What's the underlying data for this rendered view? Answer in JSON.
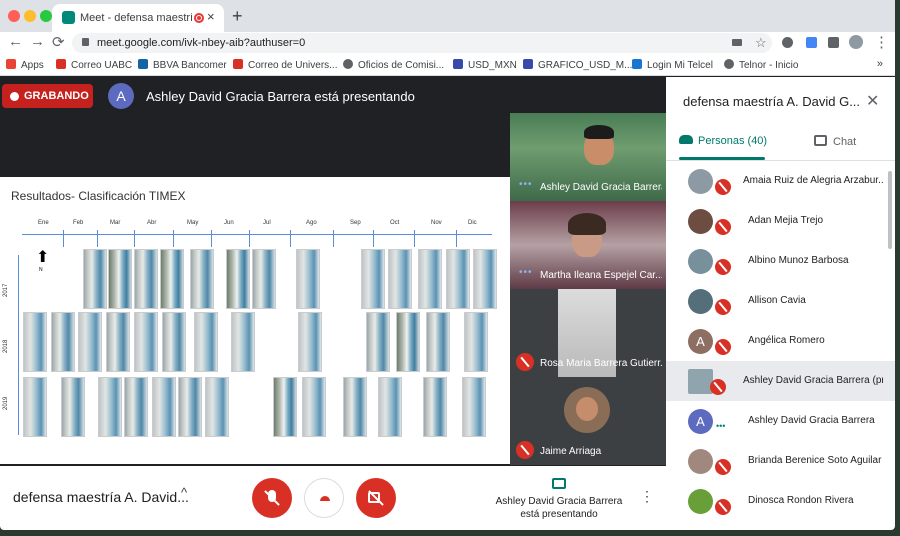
{
  "browser": {
    "tab_title": "Meet - defensa maestría A",
    "tab_close": "×",
    "new_tab": "+",
    "url": "meet.google.com/ivk-nbey-aib?authuser=0",
    "back": "←",
    "forward": "→",
    "reload": "⟳",
    "star": "☆",
    "more": "⋮"
  },
  "bookmarks": [
    {
      "label": "Apps",
      "icon": "apps-grid-icon",
      "color": "#ea4335"
    },
    {
      "label": "Correo UABC",
      "icon": "gmail-icon",
      "color": "#d93025"
    },
    {
      "label": "BBVA Bancomer",
      "icon": "bbva-icon",
      "color": "#1464a5"
    },
    {
      "label": "Correo de Univers...",
      "icon": "gmail-icon",
      "color": "#d93025"
    },
    {
      "label": "Oficios de Comisi...",
      "icon": "globe-icon",
      "color": "#5f6368"
    },
    {
      "label": "USD_MXN",
      "icon": "chart-icon",
      "color": "#3949ab"
    },
    {
      "label": "GRAFICO_USD_M...",
      "icon": "chart-icon",
      "color": "#3949ab"
    },
    {
      "label": "Login Mi Telcel",
      "icon": "telcel-icon",
      "color": "#1976d2"
    },
    {
      "label": "Telnor - Inicio",
      "icon": "globe-icon",
      "color": "#5f6368"
    }
  ],
  "bookmarks_more": "»",
  "meet": {
    "recording_label": "GRABANDO",
    "presenter_avatar": "A",
    "presenter_banner": "Ashley David Gracia Barrera está presentando",
    "slide": {
      "title": "Resultados- Clasificación TIMEX",
      "months": [
        "Ene",
        "Feb",
        "Mar",
        "Abr",
        "May",
        "Jun",
        "Jul",
        "Ago",
        "Sep",
        "Oct",
        "Nov",
        "Dic"
      ],
      "years": [
        "2017",
        "2018",
        "2019"
      ],
      "north": "N"
    },
    "tiles": [
      {
        "name": "Ashley David Gracia Barrera",
        "status": "speaking"
      },
      {
        "name": "Martha Ileana Espejel Car...",
        "status": "speaking"
      },
      {
        "name": "Rosa Maria Barrera Gutierr...",
        "status": "muted"
      },
      {
        "name": "Jaime Arriaga",
        "status": "muted"
      }
    ],
    "meeting_name": "defensa maestría A. David...",
    "meeting_chevron": "^",
    "presenting_line1": "Ashley David Gracia Barrera",
    "presenting_line2": "está presentando",
    "kebab": "⋮"
  },
  "panel": {
    "title": "defensa maestría A. David G...",
    "close": "✕",
    "people_tab": "Personas (40)",
    "chat_tab": "Chat",
    "people": [
      {
        "name": "Amaia Ruiz de Alegria Arzabur...",
        "avatar": "",
        "color": "#8d9aa4",
        "state": "muted"
      },
      {
        "name": "Adan Mejia Trejo",
        "avatar": "",
        "color": "#6d4c41",
        "state": "muted"
      },
      {
        "name": "Albino Munoz Barbosa",
        "avatar": "",
        "color": "#78909c",
        "state": "muted"
      },
      {
        "name": "Allison Cavia",
        "avatar": "",
        "color": "#546e7a",
        "state": "muted"
      },
      {
        "name": "Angélica Romero",
        "avatar": "A",
        "color": "#8d6e63",
        "state": "muted"
      },
      {
        "name": "Ashley David Gracia Barrera (pr...",
        "avatar": "",
        "color": "#90a4ae",
        "state": "muted"
      },
      {
        "name": "Ashley David Gracia Barrera",
        "avatar": "A",
        "color": "#5c6bc0",
        "state": "speaking"
      },
      {
        "name": "Brianda Berenice Soto Aguilar",
        "avatar": "",
        "color": "#a1887f",
        "state": "muted"
      },
      {
        "name": "Dinosca Rondon Rivera",
        "avatar": "",
        "color": "#689f38",
        "state": "muted"
      }
    ]
  },
  "colors": {
    "recording": "#c5221f",
    "accent": "#00796b",
    "mute": "#d93025"
  }
}
